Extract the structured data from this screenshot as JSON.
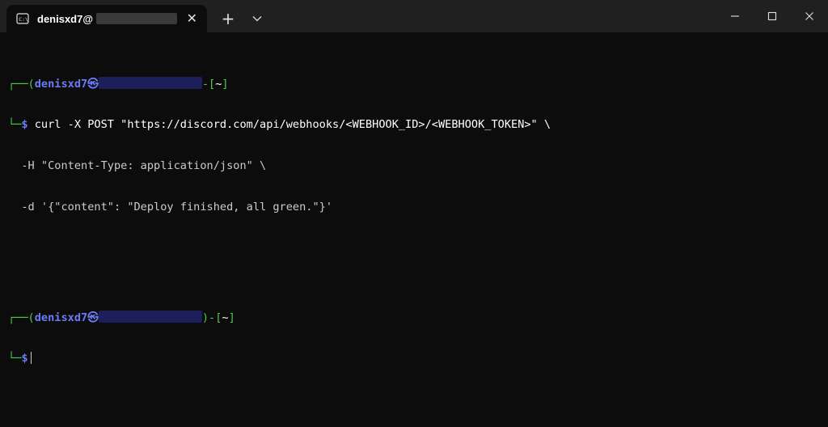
{
  "tab": {
    "title": "denisxd7@",
    "close_icon": "close-icon",
    "terminal_icon": "terminal-icon"
  },
  "toolbar": {
    "new_tab": "+",
    "dropdown": "⌄"
  },
  "window_controls": [
    "minimize-icon",
    "maximize-icon",
    "close-icon"
  ],
  "terminal": {
    "prompt_user": "denisxd7",
    "prompt_at": "㉿",
    "prompt_dir": "~",
    "prompt_symbol": "$",
    "command_line1": "curl -X POST \"https://discord.com/api/webhooks/<WEBHOOK_ID>/<WEBHOOK_TOKEN>\" \\",
    "command_line2": "  -H \"Content-Type: application/json\" \\",
    "command_line3": "  -d '{\"content\": \"Deploy finished, all green.\"}'"
  },
  "colors": {
    "prompt_green": "#4ec94e",
    "prompt_blue": "#6a7bf5",
    "background": "#0c0c0c",
    "titlebar": "#202020"
  }
}
